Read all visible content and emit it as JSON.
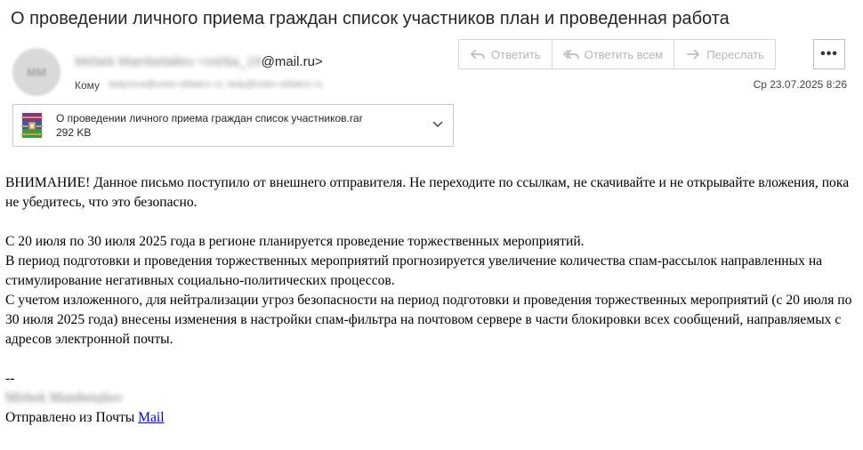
{
  "email": {
    "subject": "О проведении личного приема граждан список участников план и проведенная работа",
    "avatar_initials": "MM",
    "from_blurred": "Mirbek Mambetaliev <mirba_19",
    "from_visible": "@mail.ru>",
    "to_label": "Кому",
    "to_blurred": "ladyrova@osko-oblakm.ru; lady@osko-oblakm.ru",
    "date": "Ср 23.07.2025 8:26"
  },
  "toolbar": {
    "reply_label": "Ответить",
    "reply_all_label": "Ответить всем",
    "forward_label": "Переслать",
    "more_label": "•••"
  },
  "attachment": {
    "filename": "О проведении личного приема граждан список участников.rar",
    "size": "292 KB"
  },
  "body": {
    "warning": "ВНИМАНИЕ! Данное письмо поступило от внешнего отправителя. Не переходите по ссылкам, не скачивайте и не открывайте вложения, пока не убедитесь, что это безопасно.",
    "line1": "С 20 июля по 30 июля 2025 года в регионе планируется проведение торжественных мероприятий.",
    "line2": "В период подготовки и проведения торжественных мероприятий прогнозируется увеличение количества спам-рассылок направленных на стимулирование негативных социально-политических процессов.",
    "line3": "С учетом изложенного, для нейтрализации угроз безопасности на период подготовки и проведения торжественных мероприятий (с 20 июля по 30 июля 2025 года) внесены изменения в настройки спам-фильтра на почтовом сервере в части блокировки всех сообщений, направляемых с адресов электронной почты.",
    "sig_dash": "--",
    "sig_name_blurred": "Mirbek Mambetaliev",
    "sent_from": "Отправлено из Почты ",
    "sent_link": "Mail"
  },
  "colors": {
    "link": "#0000ee",
    "disabled_action": "#b5b5b5"
  }
}
